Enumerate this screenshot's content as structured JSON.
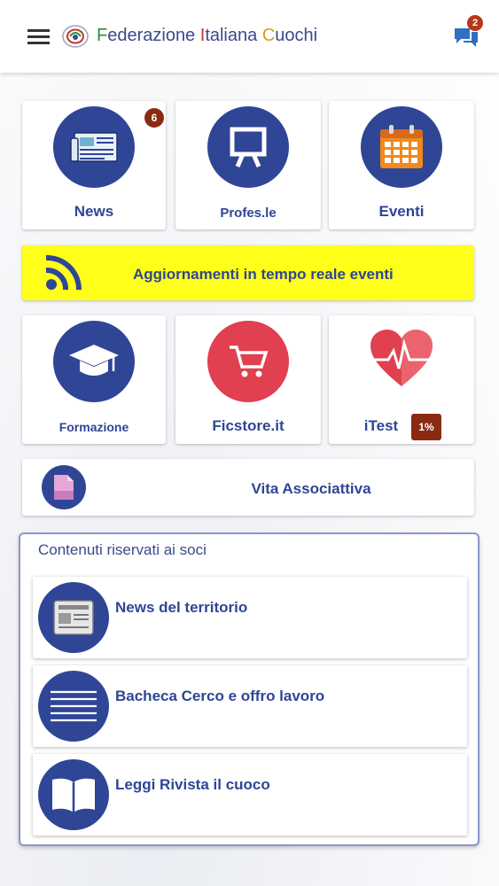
{
  "header": {
    "menu_icon": "hamburger-menu-icon",
    "logo_icon": "fic-emblem-logo",
    "title_parts": [
      "F",
      "ederazione ",
      "I",
      "taliana ",
      "C",
      "uochi"
    ],
    "chat_icon": "chat-bubbles-icon",
    "chat_badge": "2"
  },
  "tiles_row1": [
    {
      "label": "News",
      "icon": "newspaper-icon",
      "badge": "6"
    },
    {
      "label": "Profes.le",
      "icon": "presentation-board-icon"
    },
    {
      "label": "Eventi",
      "icon": "calendar-icon"
    }
  ],
  "banner": {
    "label": "Aggiornamenti in tempo reale eventi",
    "icon": "rss-feed-icon",
    "background": "#ffff1a"
  },
  "tiles_row2": [
    {
      "label": "Formazione",
      "icon": "graduation-cap-icon"
    },
    {
      "label": "Ficstore.it",
      "icon": "shopping-cart-icon"
    },
    {
      "label": "iTest",
      "icon": "heartbeat-icon",
      "badge": "1%"
    }
  ],
  "vita": {
    "label": "Vita Associattiva",
    "icon": "document-icon"
  },
  "reserved": {
    "heading": "Contenuti riservati ai soci",
    "items": [
      {
        "label": "News del territorio",
        "icon": "newspaper-icon"
      },
      {
        "label": "Bacheca Cerco e offro lavoro",
        "icon": "lined-list-icon"
      },
      {
        "label": "Leggi Rivista il cuoco",
        "icon": "open-book-icon"
      }
    ]
  },
  "colors": {
    "primary": "#2f4596",
    "badge": "#8a2a12",
    "store_red": "#e0404f",
    "calendar_orange": "#f08a1d"
  }
}
